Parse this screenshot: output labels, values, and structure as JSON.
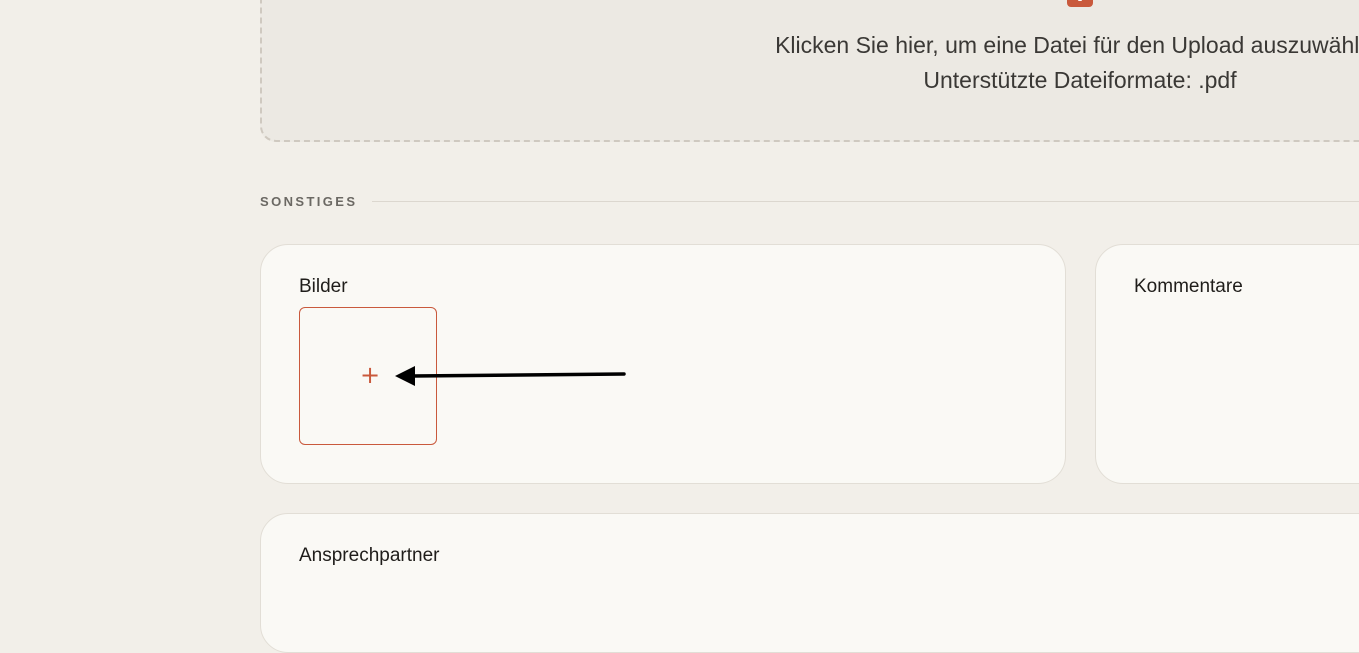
{
  "upload": {
    "icon": "upload-icon",
    "line1": "Klicken Sie hier, um eine Datei für den Upload auszuwählen",
    "line2": "Unterstützte Dateiformate: .pdf"
  },
  "section": {
    "label": "SONSTIGES"
  },
  "bilder": {
    "title": "Bilder",
    "add_icon": "+"
  },
  "kommentare": {
    "title": "Kommentare"
  },
  "ansprechpartner": {
    "title": "Ansprechpartner"
  },
  "colors": {
    "background": "#f2efe9",
    "card": "#faf9f5",
    "accent": "#c9593c",
    "text": "#1f1d1a",
    "muted": "#6b6863"
  }
}
